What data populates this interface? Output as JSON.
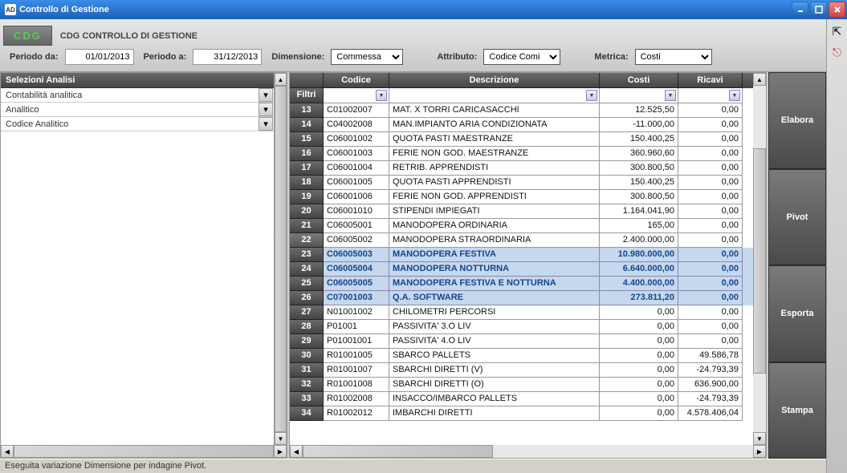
{
  "title": "Controllo di Gestione",
  "logo": "CDG",
  "toolbar_title": "CDG CONTROLLO DI GESTIONE",
  "labels": {
    "periodo_da": "Periodo da:",
    "periodo_a": "Periodo a:",
    "dimensione": "Dimensione:",
    "attributo": "Attributo:",
    "metrica": "Metrica:"
  },
  "fields": {
    "periodo_da": "01/01/2013",
    "periodo_a": "31/12/2013",
    "dimensione": "Commessa",
    "attributo": "Codice Comi",
    "metrica": "Costi"
  },
  "left_panel": {
    "header": "Selezioni Analisi",
    "rows": [
      "Contabilità analitica",
      "Analitico",
      "Codice Analitico"
    ]
  },
  "grid": {
    "headers": {
      "codice": "Codice",
      "descrizione": "Descrizione",
      "costi": "Costi",
      "ricavi": "Ricavi"
    },
    "filter_label": "Filtri",
    "rows": [
      {
        "n": "13",
        "cod": "C01002007",
        "des": "MAT. X TORRI CARICASACCHI",
        "cos": "12.525,50",
        "ric": "0,00",
        "sel": false
      },
      {
        "n": "14",
        "cod": "C04002008",
        "des": "MAN.IMPIANTO ARIA CONDIZIONATA",
        "cos": "-11.000,00",
        "ric": "0,00",
        "sel": false
      },
      {
        "n": "15",
        "cod": "C06001002",
        "des": "QUOTA PASTI MAESTRANZE",
        "cos": "150.400,25",
        "ric": "0,00",
        "sel": false
      },
      {
        "n": "16",
        "cod": "C06001003",
        "des": "FERIE NON GOD. MAESTRANZE",
        "cos": "360.960,60",
        "ric": "0,00",
        "sel": false
      },
      {
        "n": "17",
        "cod": "C06001004",
        "des": "RETRIB. APPRENDISTI",
        "cos": "300.800,50",
        "ric": "0,00",
        "sel": false
      },
      {
        "n": "18",
        "cod": "C06001005",
        "des": "QUOTA PASTI APPRENDISTI",
        "cos": "150.400,25",
        "ric": "0,00",
        "sel": false
      },
      {
        "n": "19",
        "cod": "C06001006",
        "des": "FERIE NON GOD. APPRENDISTI",
        "cos": "300.800,50",
        "ric": "0,00",
        "sel": false
      },
      {
        "n": "20",
        "cod": "C06001010",
        "des": "STIPENDI IMPIEGATI",
        "cos": "1.164.041,90",
        "ric": "0,00",
        "sel": false
      },
      {
        "n": "21",
        "cod": "C06005001",
        "des": "MANODOPERA ORDINARIA",
        "cos": "165,00",
        "ric": "0,00",
        "sel": false
      },
      {
        "n": "22",
        "cod": "C06005002",
        "des": "MANODOPERA STRAORDINARIA",
        "cos": "2.400.000,00",
        "ric": "0,00",
        "sel": false,
        "cur": true
      },
      {
        "n": "23",
        "cod": "C06005003",
        "des": "MANODOPERA FESTIVA",
        "cos": "10.980.000,00",
        "ric": "0,00",
        "sel": true
      },
      {
        "n": "24",
        "cod": "C06005004",
        "des": "MANODOPERA NOTTURNA",
        "cos": "6.640.000,00",
        "ric": "0,00",
        "sel": true
      },
      {
        "n": "25",
        "cod": "C06005005",
        "des": "MANODOPERA FESTIVA E NOTTURNA",
        "cos": "4.400.000,00",
        "ric": "0,00",
        "sel": true
      },
      {
        "n": "26",
        "cod": "C07001003",
        "des": "Q.A. SOFTWARE",
        "cos": "273.811,20",
        "ric": "0,00",
        "sel": true
      },
      {
        "n": "27",
        "cod": "N01001002",
        "des": "CHILOMETRI PERCORSI",
        "cos": "0,00",
        "ric": "0,00",
        "sel": false
      },
      {
        "n": "28",
        "cod": "P01001",
        "des": "PASSIVITA' 3.O LIV",
        "cos": "0,00",
        "ric": "0,00",
        "sel": false
      },
      {
        "n": "29",
        "cod": "P01001001",
        "des": "PASSIVITA' 4.O LIV",
        "cos": "0,00",
        "ric": "0,00",
        "sel": false
      },
      {
        "n": "30",
        "cod": "R01001005",
        "des": "SBARCO PALLETS",
        "cos": "0,00",
        "ric": "49.586,78",
        "sel": false
      },
      {
        "n": "31",
        "cod": "R01001007",
        "des": "SBARCHI DIRETTI (V)",
        "cos": "0,00",
        "ric": "-24.793,39",
        "sel": false
      },
      {
        "n": "32",
        "cod": "R01001008",
        "des": "SBARCHI DIRETTI (O)",
        "cos": "0,00",
        "ric": "636.900,00",
        "sel": false
      },
      {
        "n": "33",
        "cod": "R01002008",
        "des": "INSACCO/IMBARCO PALLETS",
        "cos": "0,00",
        "ric": "-24.793,39",
        "sel": false
      },
      {
        "n": "34",
        "cod": "R01002012",
        "des": "IMBARCHI DIRETTI",
        "cos": "0,00",
        "ric": "4.578.406,04",
        "sel": false
      }
    ]
  },
  "right_buttons": [
    "Elabora",
    "Pivot",
    "Esporta",
    "Stampa"
  ],
  "status": "Eseguita variazione Dimensione per indagine Pivot."
}
